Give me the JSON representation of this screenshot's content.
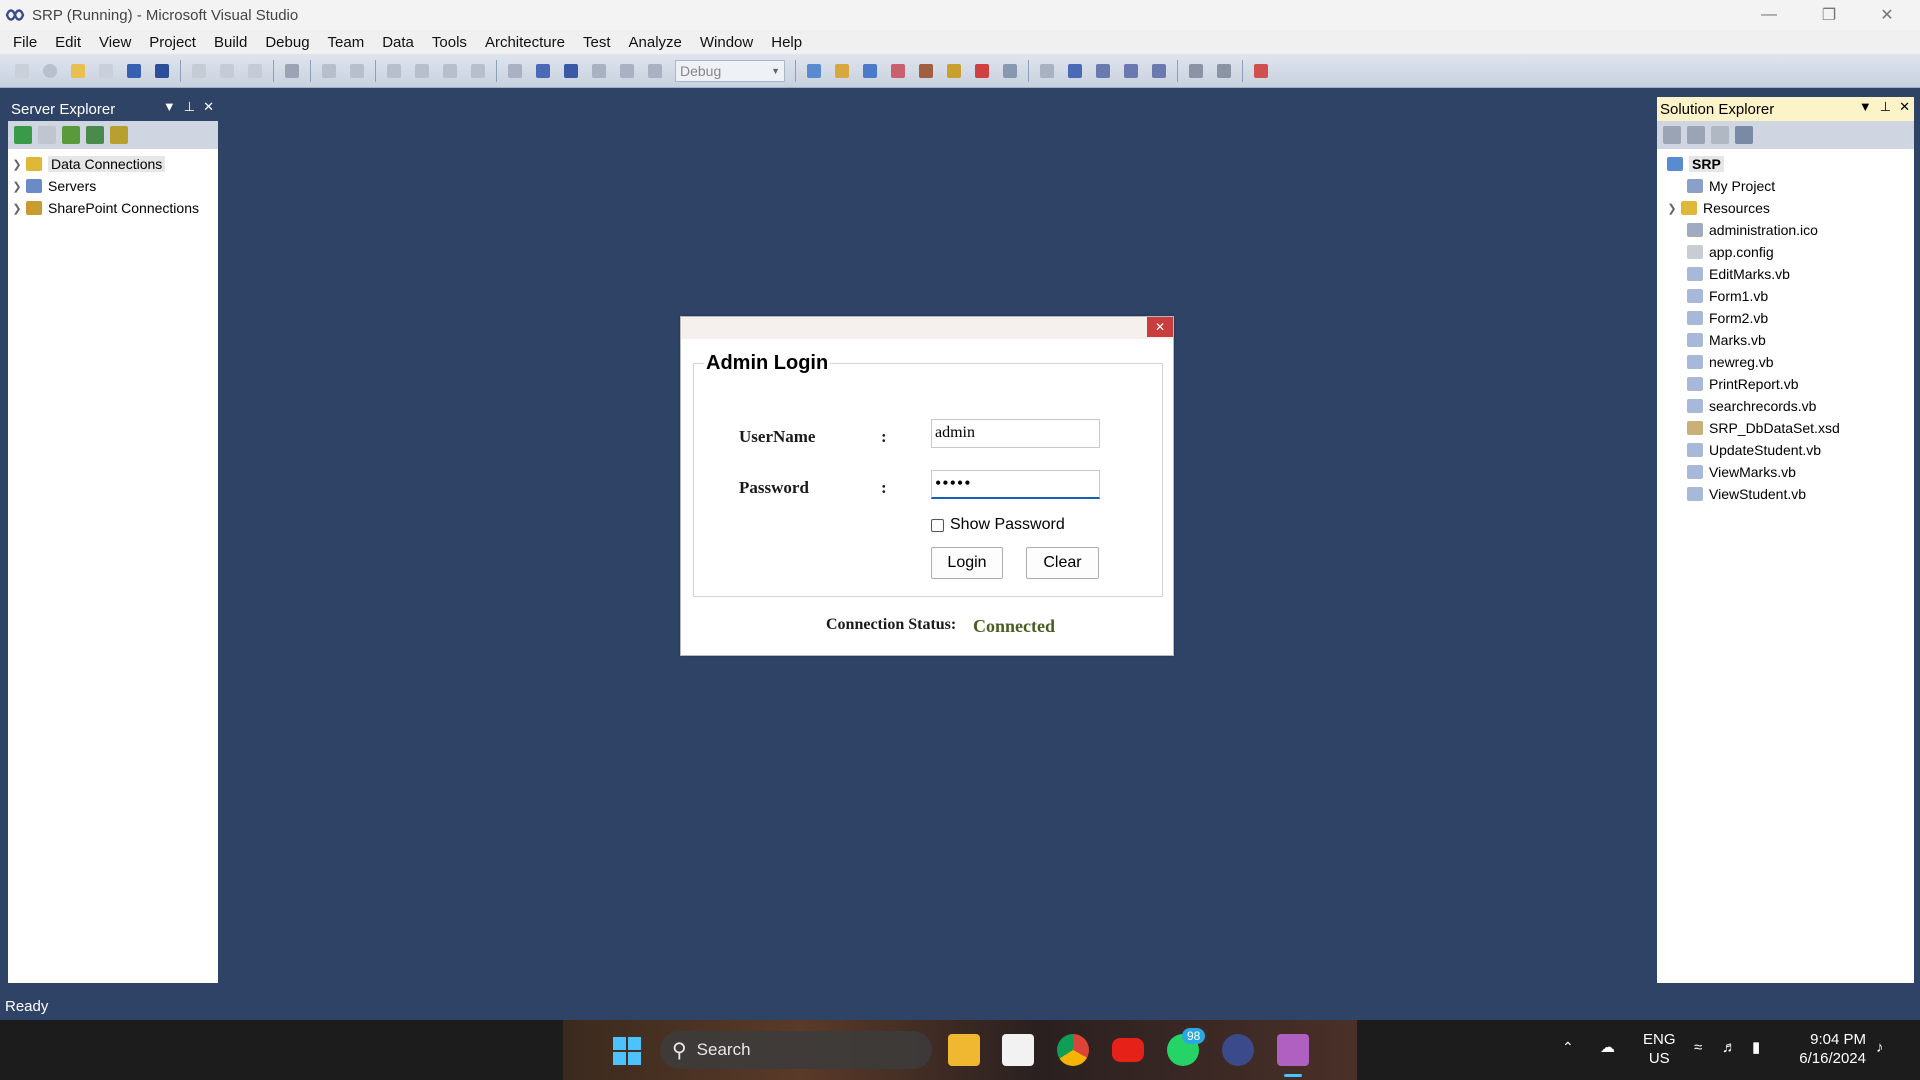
{
  "window": {
    "title": "SRP (Running) - Microsoft Visual Studio"
  },
  "menu": [
    "File",
    "Edit",
    "View",
    "Project",
    "Build",
    "Debug",
    "Team",
    "Data",
    "Tools",
    "Architecture",
    "Test",
    "Analyze",
    "Window",
    "Help"
  ],
  "toolbar": {
    "config_combo": "Debug"
  },
  "server_explorer": {
    "title": "Server Explorer",
    "items": [
      {
        "label": "Data Connections",
        "icon": "database-icon"
      },
      {
        "label": "Servers",
        "icon": "server-icon"
      },
      {
        "label": "SharePoint Connections",
        "icon": "sharepoint-icon"
      }
    ]
  },
  "solution_explorer": {
    "title": "Solution Explorer",
    "root": "SRP",
    "items": [
      "My Project",
      "Resources",
      "administration.ico",
      "app.config",
      "EditMarks.vb",
      "Form1.vb",
      "Form2.vb",
      "Marks.vb",
      "newreg.vb",
      "PrintReport.vb",
      "searchrecords.vb",
      "SRP_DbDataSet.xsd",
      "UpdateStudent.vb",
      "ViewMarks.vb",
      "ViewStudent.vb"
    ]
  },
  "dialog": {
    "group_title": "Admin Login",
    "username_label": "UserName",
    "password_label": "Password",
    "colon": ":",
    "username_value": "admin",
    "password_value": "•••••",
    "show_password_label": "Show Password",
    "login_label": "Login",
    "clear_label": "Clear",
    "connection_label": "Connection Status:",
    "connection_value": "Connected",
    "connection_color": "#4a5e23"
  },
  "statusbar": {
    "text": "Ready"
  },
  "taskbar": {
    "search_label": "Search",
    "whatsapp_badge": "98",
    "lang_top": "ENG",
    "lang_bottom": "US",
    "time": "9:04 PM",
    "date": "6/16/2024"
  }
}
